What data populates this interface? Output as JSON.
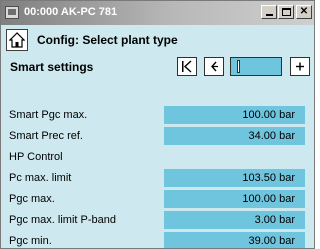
{
  "window": {
    "title": "00:000 AK-PC 781",
    "icons": {
      "app": "controller-app-icon",
      "minimize": "minimize-icon",
      "maximize": "maximize-icon",
      "close": "close-icon"
    }
  },
  "header": {
    "home_icon": "home-icon",
    "title": "Config: Select plant type"
  },
  "section": {
    "title": "Smart settings",
    "nav": {
      "first_icon": "first-page-icon",
      "prev_icon": "previous-page-icon",
      "next_icon": "next-page-icon",
      "position_fraction": 0.1
    }
  },
  "rows": [
    {
      "label": "Smart Pgc max.",
      "value": "100.00 bar"
    },
    {
      "label": "Smart Prec ref.",
      "value": "34.00 bar"
    },
    {
      "label": "HP Control",
      "value": ""
    },
    {
      "label": "Pc max. limit",
      "value": "103.50 bar"
    },
    {
      "label": "Pgc max.",
      "value": "100.00 bar"
    },
    {
      "label": "Pgc max. limit P-band",
      "value": "3.00 bar"
    },
    {
      "label": "Pgc min.",
      "value": "39.00 bar"
    }
  ],
  "colors": {
    "background": "#cde9ef",
    "value_field": "#6fc4de",
    "titlebar_start": "#7f7f7f",
    "titlebar_end": "#cfcfcf"
  }
}
